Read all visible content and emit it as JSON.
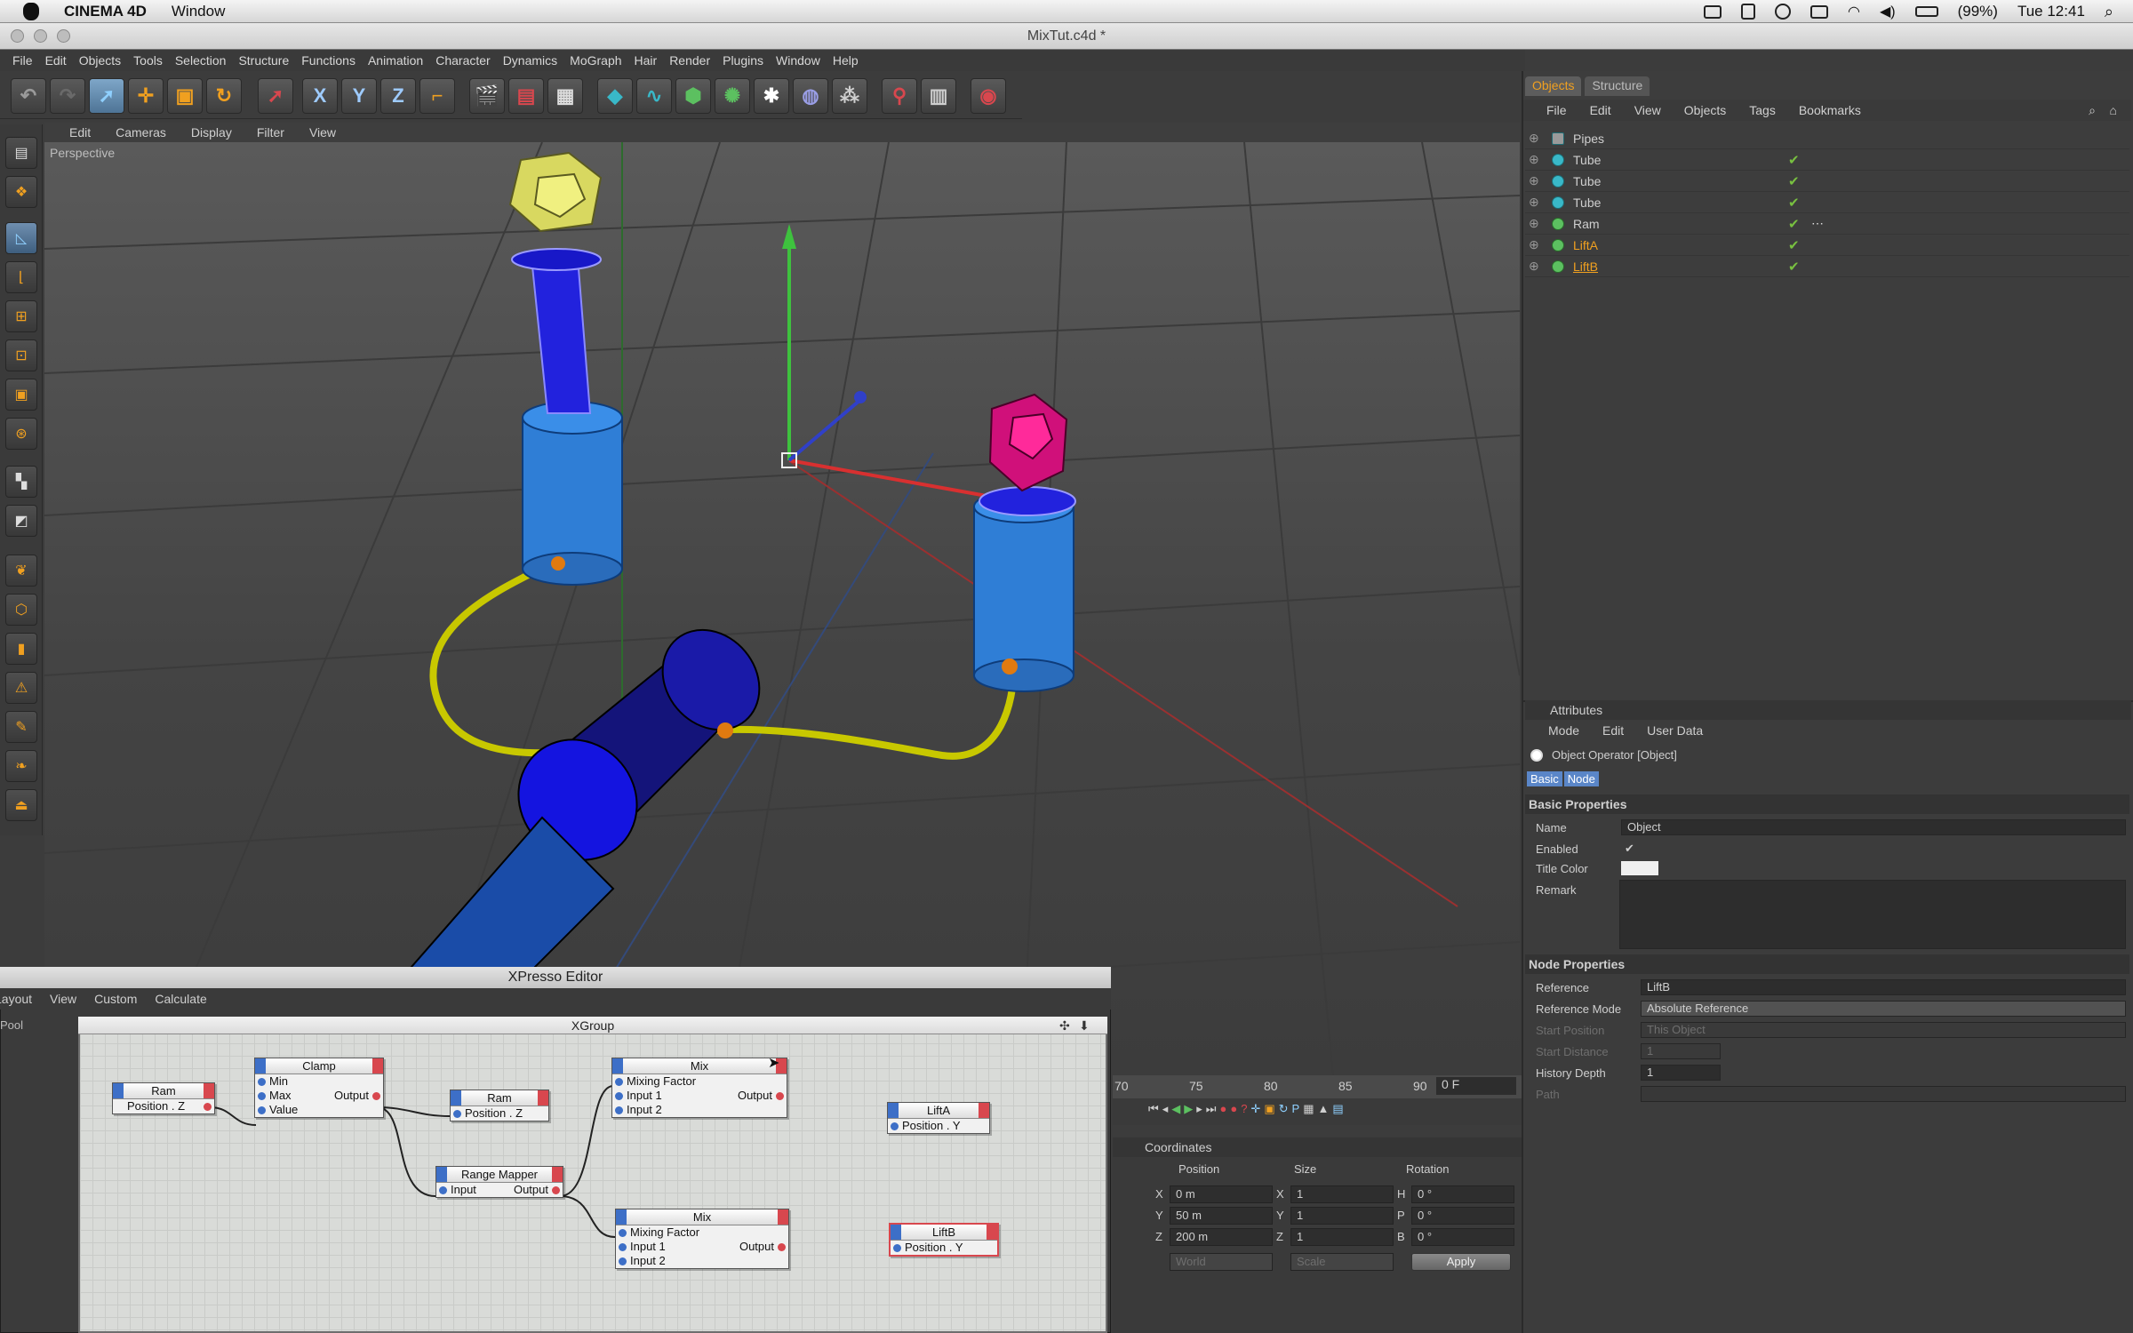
{
  "mac": {
    "app": "CINEMA 4D",
    "menu": "Window",
    "battery": "(99%)",
    "clock": "Tue 12:41"
  },
  "window": {
    "title": "MixTut.c4d *"
  },
  "mainmenu": [
    "File",
    "Edit",
    "Objects",
    "Tools",
    "Selection",
    "Structure",
    "Functions",
    "Animation",
    "Character",
    "Dynamics",
    "MoGraph",
    "Hair",
    "Render",
    "Plugins",
    "Window",
    "Help"
  ],
  "toolbar": {
    "x": "X",
    "y": "Y",
    "z": "Z"
  },
  "viewport": {
    "menu": [
      "Edit",
      "Cameras",
      "Display",
      "Filter",
      "View"
    ],
    "label": "Perspective"
  },
  "objects": {
    "tabs": [
      "Objects",
      "Structure"
    ],
    "menu": [
      "File",
      "Edit",
      "View",
      "Objects",
      "Tags",
      "Bookmarks"
    ],
    "items": [
      {
        "name": "Pipes",
        "color": "#cfcfcf"
      },
      {
        "name": "Tube",
        "color": "#cfcfcf"
      },
      {
        "name": "Tube",
        "color": "#cfcfcf"
      },
      {
        "name": "Tube",
        "color": "#cfcfcf"
      },
      {
        "name": "Ram",
        "color": "#cfcfcf"
      },
      {
        "name": "LiftA",
        "color": "#f0a020"
      },
      {
        "name": "LiftB",
        "color": "#f0a020"
      }
    ]
  },
  "attributes": {
    "header": "Attributes",
    "menu": [
      "Mode",
      "Edit",
      "User Data"
    ],
    "object_label": "Object Operator [Object]",
    "tabs": [
      "Basic",
      "Node"
    ],
    "basic": {
      "title": "Basic Properties",
      "name_label": "Name",
      "name_value": "Object",
      "enabled_label": "Enabled",
      "title_color_label": "Title Color",
      "remark_label": "Remark"
    },
    "node": {
      "title": "Node Properties",
      "reference_label": "Reference",
      "reference_value": "LiftB",
      "mode_label": "Reference Mode",
      "mode_value": "Absolute Reference",
      "start_position_label": "Start Position",
      "start_position_value": "This Object",
      "start_distance_label": "Start Distance",
      "start_distance_value": "1",
      "history_label": "History Depth",
      "history_value": "1",
      "path_label": "Path"
    }
  },
  "xpresso": {
    "title": "XPresso Editor",
    "menu": [
      "Layout",
      "View",
      "Custom",
      "Calculate"
    ],
    "pool": "Pool",
    "group": "XGroup",
    "nodes": {
      "ram1": {
        "title": "Ram",
        "port": "Position . Z"
      },
      "clamp": {
        "title": "Clamp",
        "min": "Min",
        "max": "Max",
        "value": "Value",
        "output": "Output"
      },
      "ram2": {
        "title": "Ram",
        "port": "Position . Z"
      },
      "range": {
        "title": "Range Mapper",
        "input": "Input",
        "output": "Output"
      },
      "mix1": {
        "title": "Mix",
        "factor": "Mixing Factor",
        "in1": "Input 1",
        "in2": "Input 2",
        "output": "Output"
      },
      "mix2": {
        "title": "Mix",
        "factor": "Mixing Factor",
        "in1": "Input 1",
        "in2": "Input 2",
        "output": "Output"
      },
      "lifta": {
        "title": "LiftA",
        "port": "Position . Y"
      },
      "liftb": {
        "title": "LiftB",
        "port": "Position . Y"
      }
    }
  },
  "timeline": {
    "ticks": [
      "70",
      "75",
      "80",
      "85",
      "90"
    ],
    "frame": "0 F"
  },
  "coordinates": {
    "title": "Coordinates",
    "headers": [
      "Position",
      "Size",
      "Rotation"
    ],
    "rows": [
      {
        "axis": "X",
        "pos": "0 m",
        "saxis": "X",
        "size": "1",
        "raxis": "H",
        "rot": "0 °"
      },
      {
        "axis": "Y",
        "pos": "50 m",
        "saxis": "Y",
        "size": "1",
        "raxis": "P",
        "rot": "0 °"
      },
      {
        "axis": "Z",
        "pos": "200 m",
        "saxis": "Z",
        "size": "1",
        "raxis": "B",
        "rot": "0 °"
      }
    ],
    "space": "World",
    "scale": "Scale",
    "apply": "Apply"
  }
}
